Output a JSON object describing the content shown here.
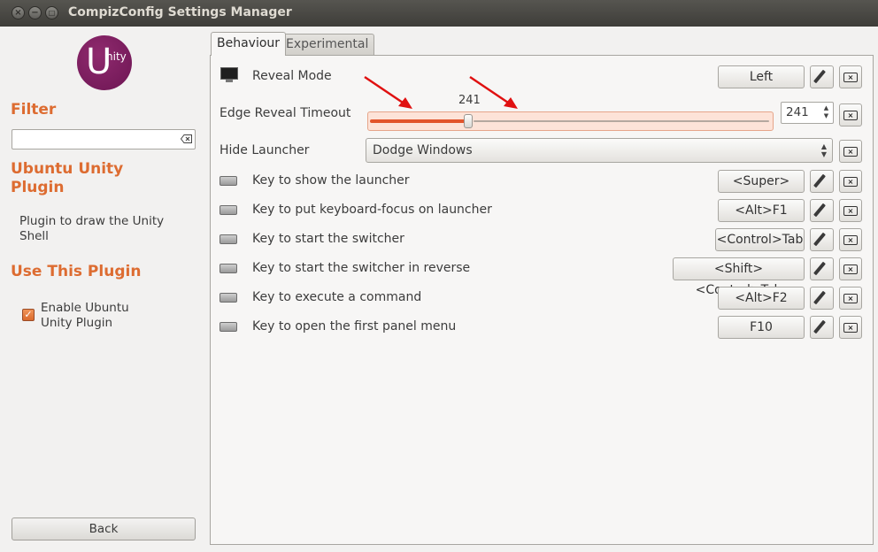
{
  "window": {
    "title": "CompizConfig Settings Manager",
    "close_glyph": "×",
    "minimize_glyph": "−",
    "maximize_glyph": "□"
  },
  "sidebar": {
    "logo": {
      "letter": "U",
      "suffix": "nity"
    },
    "filter_heading": "Filter",
    "filter_value": "",
    "plugin_heading": "Ubuntu Unity Plugin",
    "plugin_description": "Plugin to draw the Unity Shell",
    "use_heading": "Use This Plugin",
    "enable_label": "Enable Ubuntu Unity Plugin",
    "enable_checked": true,
    "back_label": "Back"
  },
  "tabs": [
    {
      "label": "Behaviour",
      "active": true
    },
    {
      "label": "Experimental",
      "active": false
    }
  ],
  "settings": {
    "reveal_mode": {
      "label": "Reveal Mode",
      "value": "Left"
    },
    "edge_reveal_timeout": {
      "label": "Edge Reveal Timeout",
      "value": "241",
      "fraction": 0.245
    },
    "hide_launcher": {
      "label": "Hide Launcher",
      "value": "Dodge Windows"
    },
    "keys": [
      {
        "label": "Key to show the launcher",
        "value": "<Super>"
      },
      {
        "label": "Key to put keyboard-focus on launcher",
        "value": "<Alt>F1"
      },
      {
        "label": "Key to start the switcher",
        "value": "<Control>Tab"
      },
      {
        "label": "Key to start the switcher in reverse",
        "value": "<Shift><Control>Tab"
      },
      {
        "label": "Key to execute a command",
        "value": "<Alt>F2"
      },
      {
        "label": "Key to open the first panel menu",
        "value": "F10"
      }
    ]
  },
  "icons": {
    "edit": "pencil-icon",
    "reset": "clear-icon",
    "keyboard": "keyboard-icon",
    "monitor": "monitor-icon",
    "annotation": "red-arrow"
  },
  "colors": {
    "accent": "#dd6c31",
    "slider_fill": "#e2552b",
    "annotation_arrow": "#e01010",
    "logo": "#772953"
  }
}
